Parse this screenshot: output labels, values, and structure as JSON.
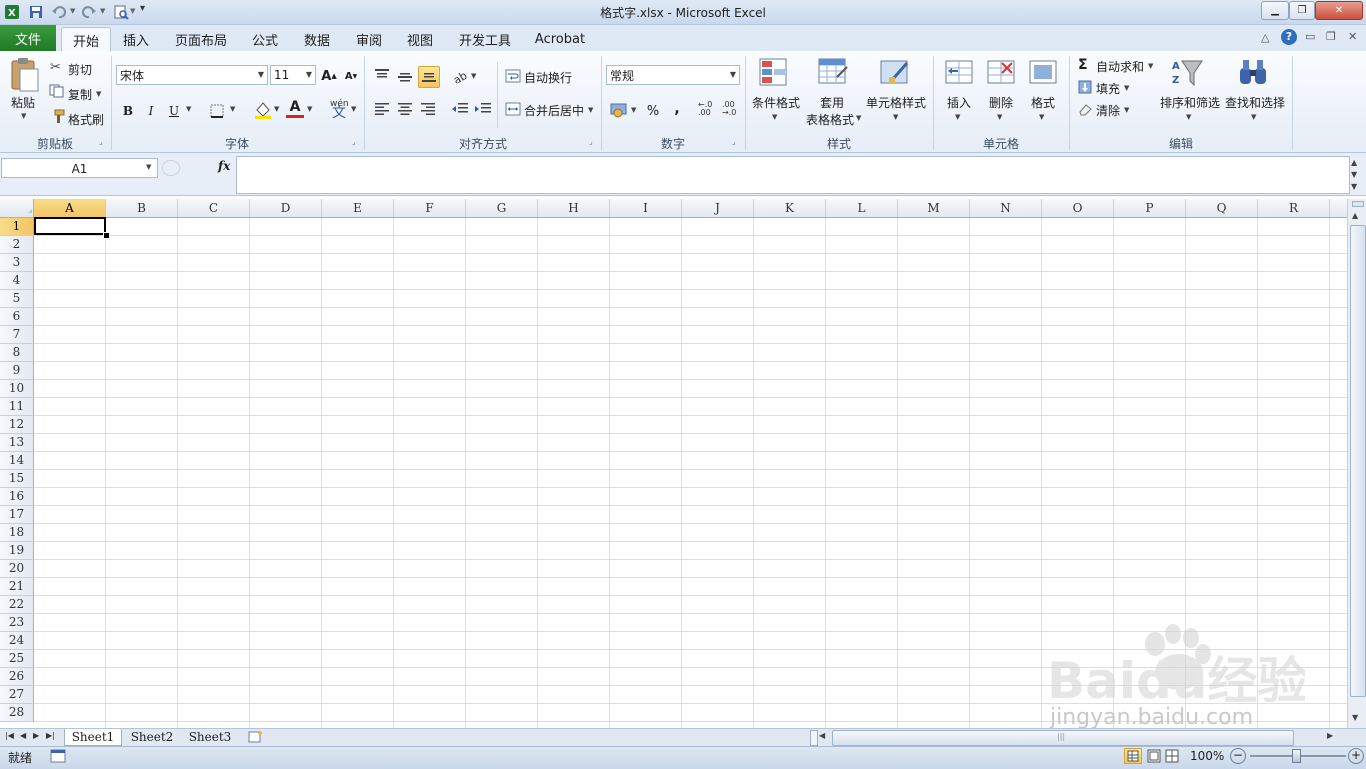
{
  "window": {
    "title": "格式字.xlsx  -  Microsoft Excel",
    "buttons": [
      "minimize",
      "restore",
      "close"
    ]
  },
  "qat": {
    "icons": [
      "excel-app-icon",
      "save-icon",
      "undo-icon",
      "redo-icon",
      "print-preview-icon",
      "customize-icon"
    ]
  },
  "tabs": {
    "file": "文件",
    "items": [
      "开始",
      "插入",
      "页面布局",
      "公式",
      "数据",
      "审阅",
      "视图",
      "开发工具",
      "Acrobat"
    ],
    "active": "开始"
  },
  "ribbon": {
    "clipboard": {
      "label": "剪贴板",
      "paste": "粘贴",
      "cut": "剪切",
      "copy": "复制",
      "format_painter": "格式刷"
    },
    "font": {
      "label": "字体",
      "font_name": "宋体",
      "font_size": "11",
      "bold": "B",
      "italic": "I",
      "underline": "U",
      "grow": "A",
      "shrink": "A",
      "font_color_letter": "A",
      "phonetic": "wén"
    },
    "alignment": {
      "label": "对齐方式",
      "wrap": "自动换行",
      "merge": "合并后居中"
    },
    "number": {
      "label": "数字",
      "format": "常规",
      "percent": "%",
      "comma": ","
    },
    "styles": {
      "label": "样式",
      "conditional": "条件格式",
      "table_format_1": "套用",
      "table_format_2": "表格格式",
      "cell_styles": "单元格样式"
    },
    "cells": {
      "label": "单元格",
      "insert": "插入",
      "delete": "删除",
      "format": "格式"
    },
    "editing": {
      "label": "编辑",
      "autosum": "自动求和",
      "fill": "填充",
      "clear": "清除",
      "sort": "排序和筛选",
      "find": "查找和选择"
    }
  },
  "formula_bar": {
    "name_box": "A1",
    "fx": "fx",
    "content": ""
  },
  "grid": {
    "columns": [
      "A",
      "B",
      "C",
      "D",
      "E",
      "F",
      "G",
      "H",
      "I",
      "J",
      "K",
      "L",
      "M",
      "N",
      "O",
      "P",
      "Q",
      "R"
    ],
    "rows": [
      "1",
      "2",
      "3",
      "4",
      "5",
      "6",
      "7",
      "8",
      "9",
      "10",
      "11",
      "12",
      "13",
      "14",
      "15",
      "16",
      "17",
      "18",
      "19",
      "20",
      "21",
      "22",
      "23",
      "24",
      "25",
      "26",
      "27",
      "28"
    ],
    "selected_cell": "A1"
  },
  "sheets": {
    "items": [
      "Sheet1",
      "Sheet2",
      "Sheet3"
    ],
    "active": "Sheet1"
  },
  "status": {
    "ready": "就绪",
    "zoom": "100%"
  },
  "watermark": {
    "text": "jingyan.baidu.com",
    "brand": "Baidu经验"
  },
  "colors": {
    "file_tab": "#2a8a2e",
    "selected_header": "#f5cc6c",
    "ribbon_bg": "#e5edf7"
  }
}
